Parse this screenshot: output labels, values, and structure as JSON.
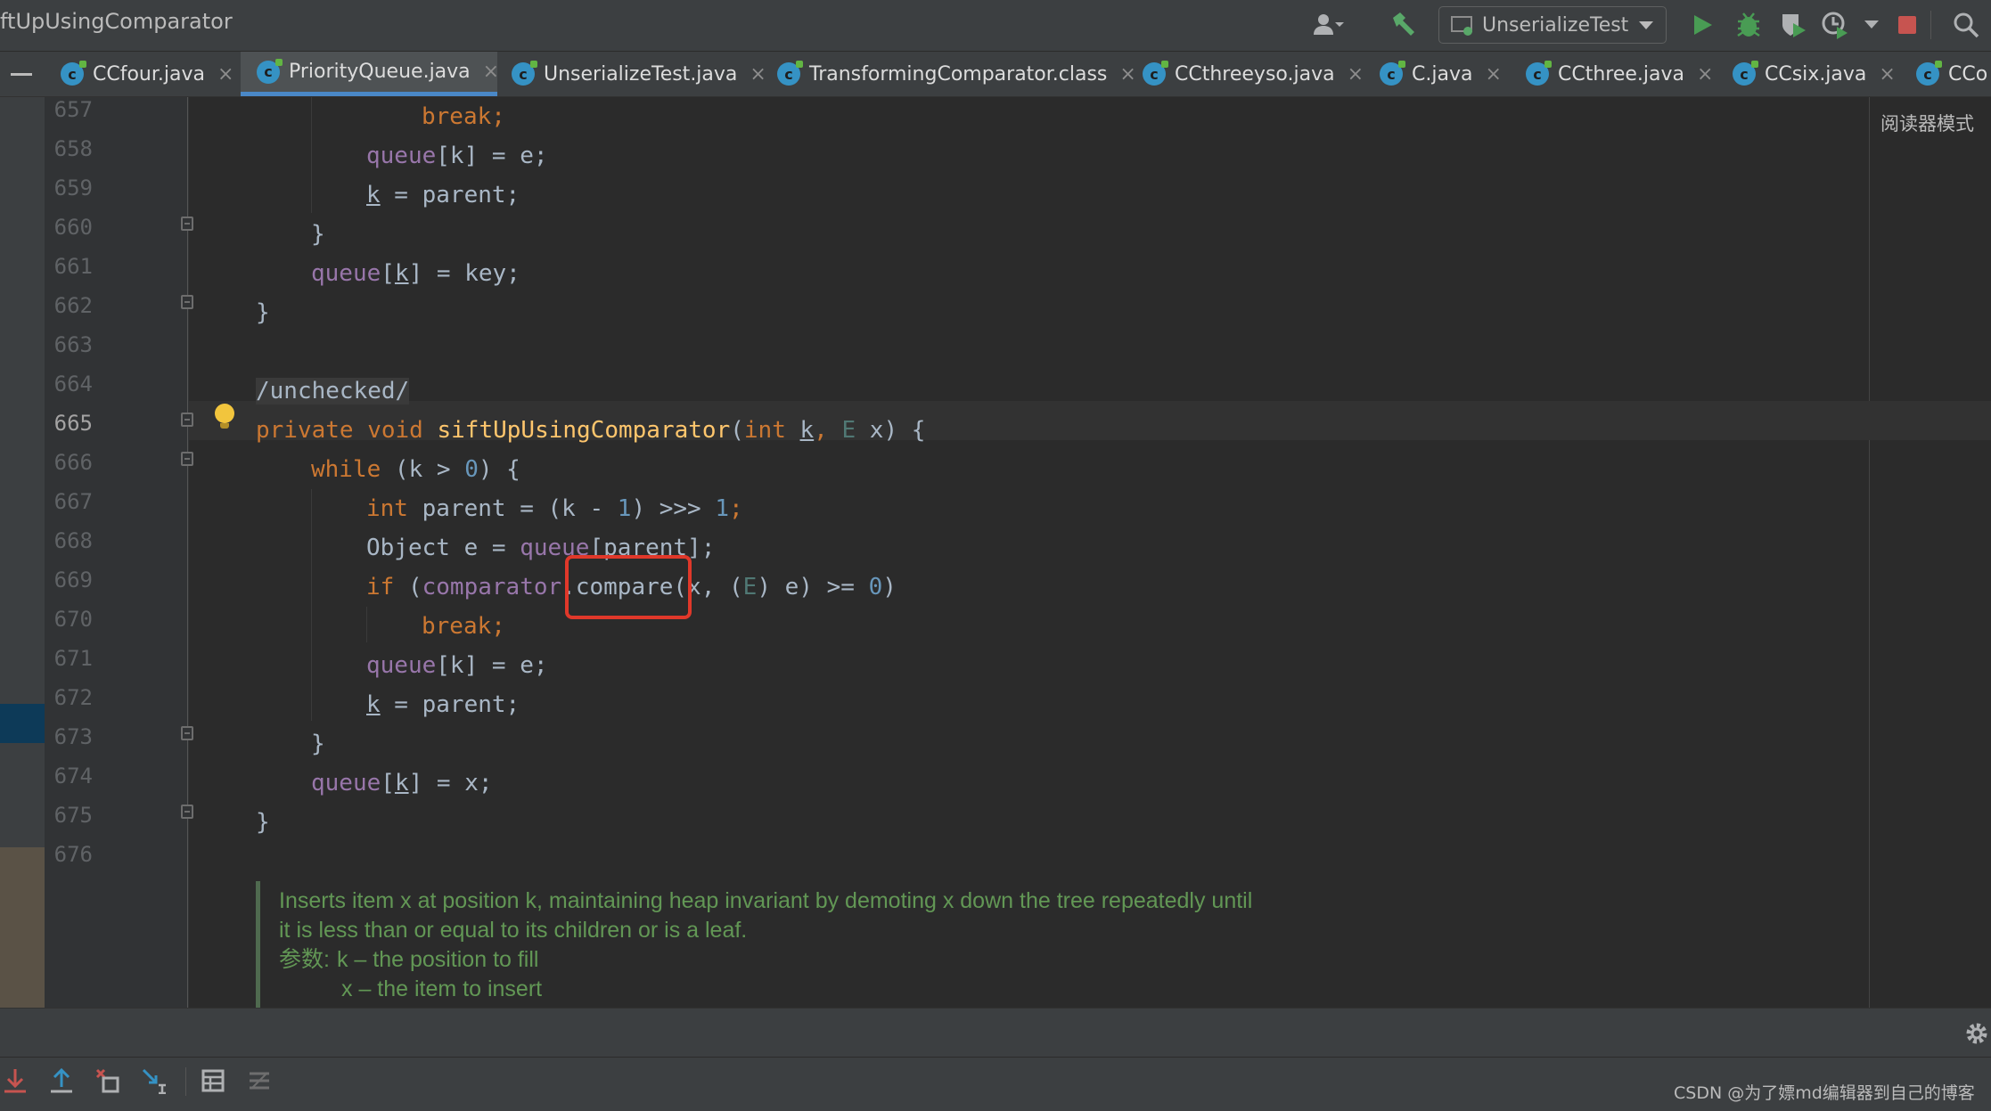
{
  "toolbar": {
    "breadcrumb": "ftUpUsingComparator",
    "run_config": "UnserializeTest",
    "icons": [
      "user-icon",
      "build-hammer-icon",
      "run-icon",
      "debug-icon",
      "coverage-icon",
      "profile-icon",
      "stop-icon",
      "search-icon"
    ]
  },
  "tabs": [
    {
      "label": "CCfour.java",
      "active": false
    },
    {
      "label": "PriorityQueue.java",
      "active": true
    },
    {
      "label": "UnserializeTest.java",
      "active": false
    },
    {
      "label": "TransformingComparator.class",
      "active": false
    },
    {
      "label": "CCthreeyso.java",
      "active": false
    },
    {
      "label": "C.java",
      "active": false
    },
    {
      "label": "CCthree.java",
      "active": false
    },
    {
      "label": "CCsix.java",
      "active": false
    },
    {
      "label": "CCo",
      "active": false
    }
  ],
  "tab_icon_letter": "c",
  "tab_close": "×",
  "editor": {
    "reader_mode": "阅读器模式",
    "current_line": "665",
    "line_numbers": [
      "657",
      "658",
      "659",
      "660",
      "661",
      "662",
      "663",
      "664",
      "665",
      "666",
      "667",
      "668",
      "669",
      "670",
      "671",
      "672",
      "673",
      "674",
      "675",
      "676"
    ],
    "code": {
      "l657": "break;",
      "l658": [
        "queue",
        "[k] = e;"
      ],
      "l659": [
        "k",
        " = parent;"
      ],
      "l660": "}",
      "l661": [
        "queue",
        "[",
        "k",
        "] = key;"
      ],
      "l662": "}",
      "l664": "/unchecked/",
      "l665": [
        "private void ",
        "siftUpUsingComparator",
        "(",
        "int ",
        "k",
        ", ",
        "E",
        " x) {"
      ],
      "l666": [
        "while",
        " (k > ",
        "0",
        ") {"
      ],
      "l667": [
        "int",
        " parent = (k - ",
        "1",
        ") >>> ",
        "1",
        ";"
      ],
      "l668": [
        "Object e = ",
        "queue",
        "[parent];"
      ],
      "l669": [
        "if",
        " (",
        "comparator",
        ".compare(x, (",
        "E",
        ") e) >= ",
        "0",
        ")"
      ],
      "l670": "break;",
      "l671": [
        "queue",
        "[k] = e;"
      ],
      "l672": [
        "k",
        " = parent;"
      ],
      "l673": "}",
      "l674": [
        "queue",
        "[",
        "k",
        "] = x;"
      ],
      "l675": "}"
    },
    "doc": {
      "line1": "Inserts item x at position k, maintaining heap invariant by demoting x down the tree repeatedly until",
      "line2": "it is less than or equal to its children or is a leaf.",
      "param_label": "参数:",
      "param1": "k – the position to fill",
      "param2": "x – the item to insert"
    },
    "highlight_color": "#e0382a"
  },
  "bottom": {
    "icons": [
      "download-icon",
      "upload-icon",
      "delete-icon",
      "step-into-icon",
      "table-icon",
      "list-icon",
      "settings-gear-icon"
    ],
    "watermark": "CSDN @为了嫖md编辑器到自己的博客"
  },
  "colors": {
    "keyword": "#cc7832",
    "field": "#9876aa",
    "number": "#6897bb",
    "method": "#ffc66d",
    "doc": "#629755",
    "tab_accent": "#4a88c7",
    "run_green": "#499c54",
    "stop_red": "#c75450"
  }
}
